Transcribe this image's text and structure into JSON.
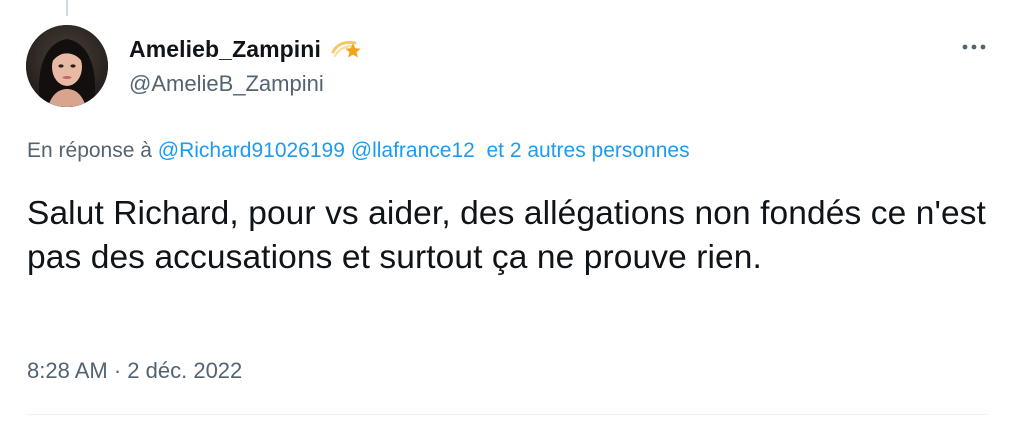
{
  "tweet": {
    "author": {
      "display_name": "Amelieb_Zampini",
      "handle": "@AmelieB_Zampini",
      "badge_icon": "shooting-star-icon"
    },
    "more_icon": "ellipsis-icon",
    "reply": {
      "prefix": "En réponse à",
      "mention_1": "@Richard91026199",
      "mention_2": "@llafrance12",
      "others": "et 2 autres personnes"
    },
    "text": "Salut Richard, pour vs aider, des allégations non fondés ce n'est pas des accusations et surtout ça ne prouve rien.",
    "time": "8:28 AM",
    "separator": "·",
    "date": "2 déc. 2022"
  },
  "colors": {
    "text_primary": "#0f1419",
    "text_secondary": "#536471",
    "link": "#1d9bf0",
    "divider": "#eff3f4"
  }
}
